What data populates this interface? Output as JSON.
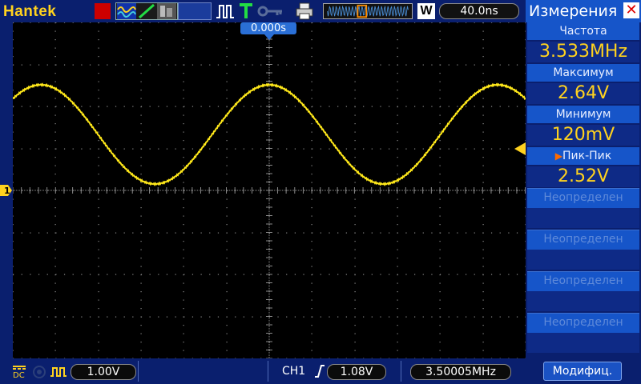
{
  "top": {
    "brand": "Hantek",
    "timebase": "40.0ns",
    "w_label": "W",
    "trigger_position": "0.000s"
  },
  "panel": {
    "title": "Измерения",
    "close_glyph": "✕",
    "measurements": [
      {
        "label": "Частота",
        "value": "3.533MHz",
        "selected": false
      },
      {
        "label": "Максимум",
        "value": "2.64V",
        "selected": false
      },
      {
        "label": "Минимум",
        "value": "120mV",
        "selected": false
      },
      {
        "label": "Пик-Пик",
        "value": "2.52V",
        "selected": true
      }
    ],
    "undefined_slots": [
      "Неопределен",
      "Неопределен",
      "Неопределен",
      "Неопределен",
      "Неопределен"
    ],
    "modify_button": "Модифиц."
  },
  "bottom": {
    "ch_volts": "1.00V",
    "trigger_channel": "CH1",
    "trigger_level": "1.08V",
    "frequency": "3.50005MHz",
    "coupling": "DC"
  },
  "colors": {
    "trace": "#ffe81a",
    "panel_label": "#1655c9",
    "accent": "#ffd21e"
  },
  "icons": [
    "waveform-icon",
    "line-icon",
    "dots-icon",
    "pulse-icon",
    "trigger-t-icon",
    "key-icon",
    "printer-icon",
    "close-icon",
    "trigger-edge-icon",
    "ch1-marker-icon"
  ]
}
